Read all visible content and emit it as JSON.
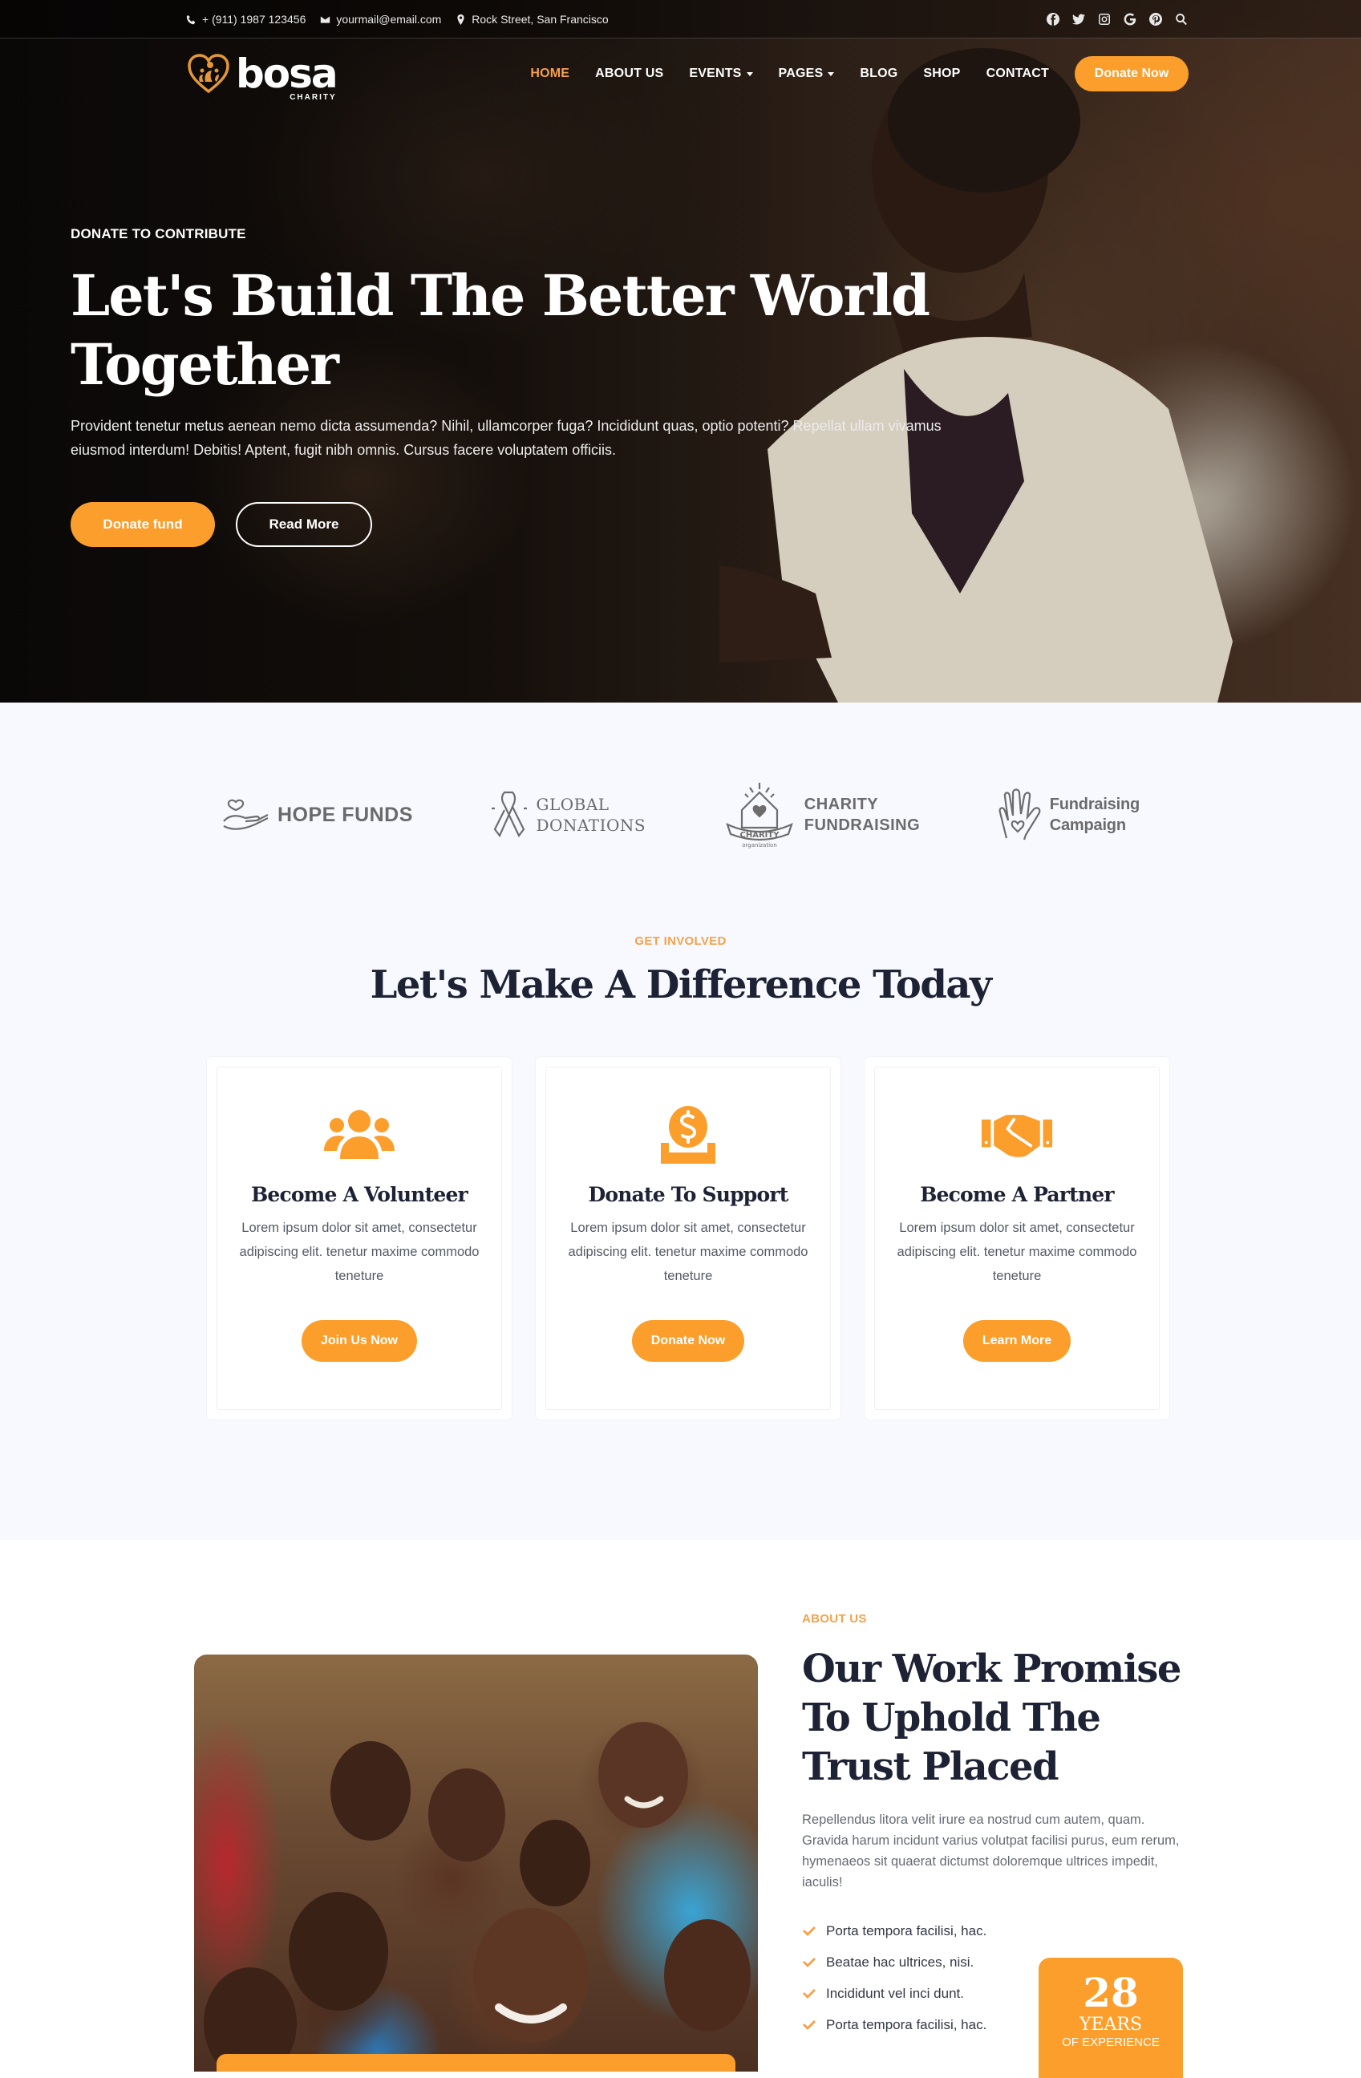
{
  "topbar": {
    "phone": "+ (911) 1987 123456",
    "email": "yourmail@email.com",
    "address": "Rock Street, San Francisco",
    "social_icons": [
      "facebook-icon",
      "twitter-icon",
      "instagram-icon",
      "google-icon",
      "pinterest-icon",
      "search-icon"
    ]
  },
  "nav": {
    "logo_word": "bosa",
    "logo_sub": "CHARITY",
    "items": [
      {
        "label": "HOME",
        "active": true
      },
      {
        "label": "ABOUT US"
      },
      {
        "label": "EVENTS",
        "dropdown": true
      },
      {
        "label": "PAGES",
        "dropdown": true
      },
      {
        "label": "BLOG"
      },
      {
        "label": "SHOP"
      },
      {
        "label": "CONTACT"
      }
    ],
    "donate_label": "Donate Now"
  },
  "hero": {
    "eyebrow": "DONATE TO CONTRIBUTE",
    "title_line1": "Let's Build The Better World",
    "title_line2": "Together",
    "text": "Provident tenetur metus aenean nemo dicta assumenda? Nihil, ullamcorper fuga? Incididunt quas, optio potenti? Repellat ullam vivamus eiusmod interdum! Debitis! Aptent, fugit nibh omnis. Cursus facere voluptatem officiis.",
    "primary_button": "Donate fund",
    "secondary_button": "Read More"
  },
  "partners": [
    {
      "line1": "HOPE FUNDS",
      "line2": ""
    },
    {
      "line1": "GLOBAL",
      "line2": "DONATIONS"
    },
    {
      "line1": "CHARITY",
      "line2": "FUNDRAISING",
      "badge": "CHARITY",
      "badge_sub": "organization"
    },
    {
      "line1": "Fundraising",
      "line2": "Campaign"
    }
  ],
  "involved": {
    "eyebrow": "GET INVOLVED",
    "title": "Let's Make A Difference Today",
    "cards": [
      {
        "icon": "users-icon",
        "title": "Become A Volunteer",
        "text": "Lorem ipsum dolor sit amet, consectetur adipiscing elit. tenetur maxime  commodo teneture",
        "button": "Join Us Now"
      },
      {
        "icon": "donate-coin-icon",
        "title": "Donate To Support",
        "text": "Lorem ipsum dolor sit amet, consectetur adipiscing elit. tenetur maxime  commodo teneture",
        "button": "Donate Now"
      },
      {
        "icon": "handshake-icon",
        "title": "Become A Partner",
        "text": "Lorem ipsum dolor sit amet, consectetur adipiscing elit. tenetur maxime  commodo teneture",
        "button": "Learn More"
      }
    ]
  },
  "about": {
    "eyebrow": "ABOUT US",
    "title_line1": "Our Work Promise",
    "title_line2": "To Uphold The",
    "title_line3": "Trust Placed",
    "text": "Repellendus litora velit irure ea nostrud cum autem, quam. Gravida harum incidunt varius volutpat facilisi purus, eum rerum, hymenaeos sit quaerat dictumst doloremque ultrices impedit, iaculis!",
    "checklist": [
      "Porta tempora facilisi, hac.",
      "Beatae hac ultrices, nisi.",
      "Incididunt vel inci dunt.",
      "Porta tempora facilisi, hac."
    ],
    "experience": {
      "number": "28",
      "label": "YEARS",
      "sub": "OF EXPERIENCE"
    }
  },
  "colors": {
    "accent": "#fb9e2b",
    "heading": "#1e2235",
    "section_bg": "#f8f9fe"
  }
}
